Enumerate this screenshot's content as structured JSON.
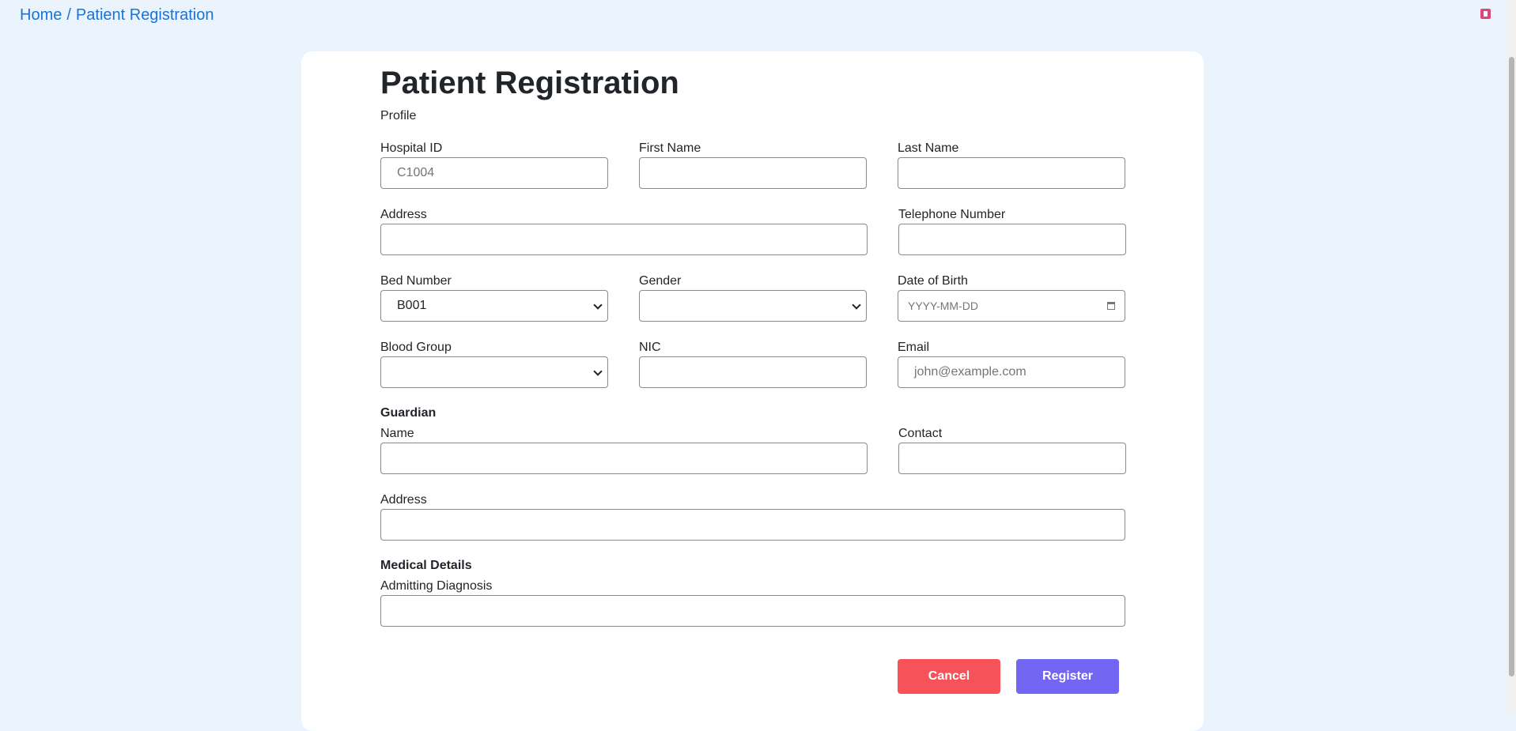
{
  "breadcrumb": {
    "home": "Home",
    "separator": "/",
    "current": "Patient Registration"
  },
  "page": {
    "title": "Patient Registration",
    "profile_label": "Profile"
  },
  "fields": {
    "hospital_id": {
      "label": "Hospital ID",
      "value": "C1004"
    },
    "first_name": {
      "label": "First Name",
      "value": ""
    },
    "last_name": {
      "label": "Last Name",
      "value": ""
    },
    "address": {
      "label": "Address",
      "value": ""
    },
    "telephone": {
      "label": "Telephone Number",
      "value": ""
    },
    "bed_number": {
      "label": "Bed Number",
      "value": "B001"
    },
    "gender": {
      "label": "Gender",
      "value": ""
    },
    "dob": {
      "label": "Date of Birth",
      "placeholder": "YYYY-MM-DD"
    },
    "blood_group": {
      "label": "Blood Group",
      "value": ""
    },
    "nic": {
      "label": "NIC",
      "value": ""
    },
    "email": {
      "label": "Email",
      "placeholder": "john@example.com"
    }
  },
  "guardian": {
    "heading": "Guardian",
    "name": {
      "label": "Name",
      "value": ""
    },
    "contact": {
      "label": "Contact",
      "value": ""
    },
    "address": {
      "label": "Address",
      "value": ""
    }
  },
  "medical": {
    "heading": "Medical Details",
    "diagnosis": {
      "label": "Admitting Diagnosis",
      "value": ""
    }
  },
  "actions": {
    "cancel": "Cancel",
    "register": "Register"
  },
  "colors": {
    "background": "#ebf3fd",
    "link": "#1a73d9",
    "cancel": "#f55259",
    "register": "#7266f3"
  },
  "icons": {
    "corner": "trash-icon",
    "date": "calendar-icon"
  }
}
